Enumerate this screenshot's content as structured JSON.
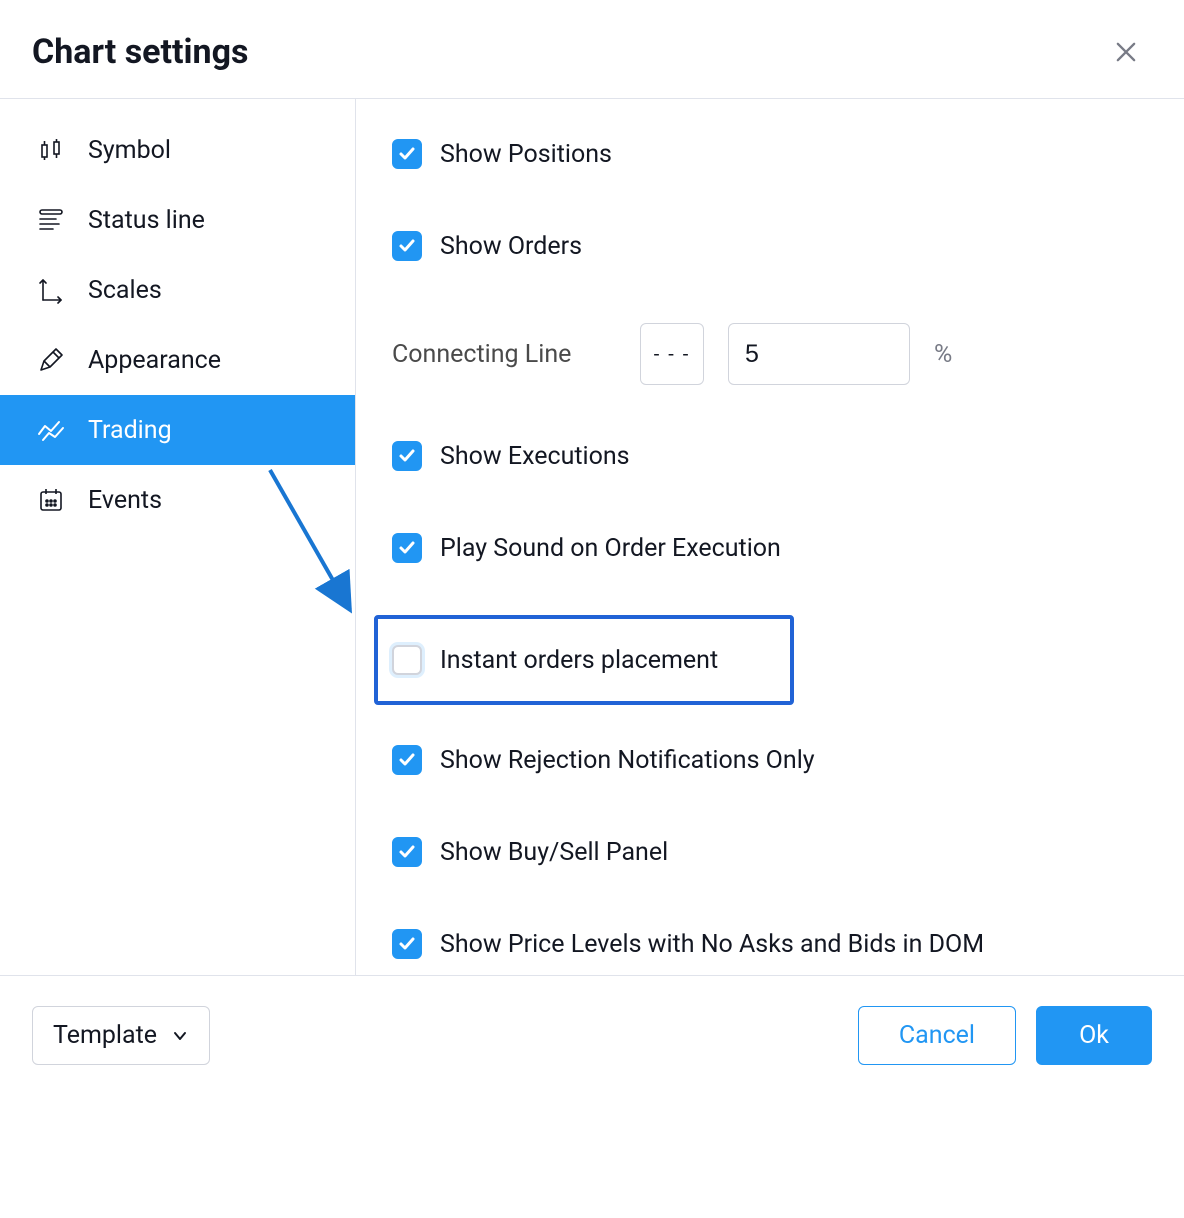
{
  "title": "Chart settings",
  "sidebar": {
    "items": [
      {
        "label": "Symbol"
      },
      {
        "label": "Status line"
      },
      {
        "label": "Scales"
      },
      {
        "label": "Appearance"
      },
      {
        "label": "Trading"
      },
      {
        "label": "Events"
      }
    ]
  },
  "trading": {
    "show_positions": "Show Positions",
    "show_orders": "Show Orders",
    "connecting_line_label": "Connecting Line",
    "connecting_line_style": "- - -",
    "connecting_line_value": "5",
    "connecting_line_unit": "%",
    "show_executions": "Show Executions",
    "play_sound": "Play Sound on Order Execution",
    "instant_orders": "Instant orders placement",
    "show_rejection": "Show Rejection Notifications Only",
    "show_buy_sell": "Show Buy/Sell Panel",
    "show_price_levels": "Show Price Levels with No Asks and Bids in DOM"
  },
  "footer": {
    "template": "Template",
    "cancel": "Cancel",
    "ok": "Ok"
  }
}
